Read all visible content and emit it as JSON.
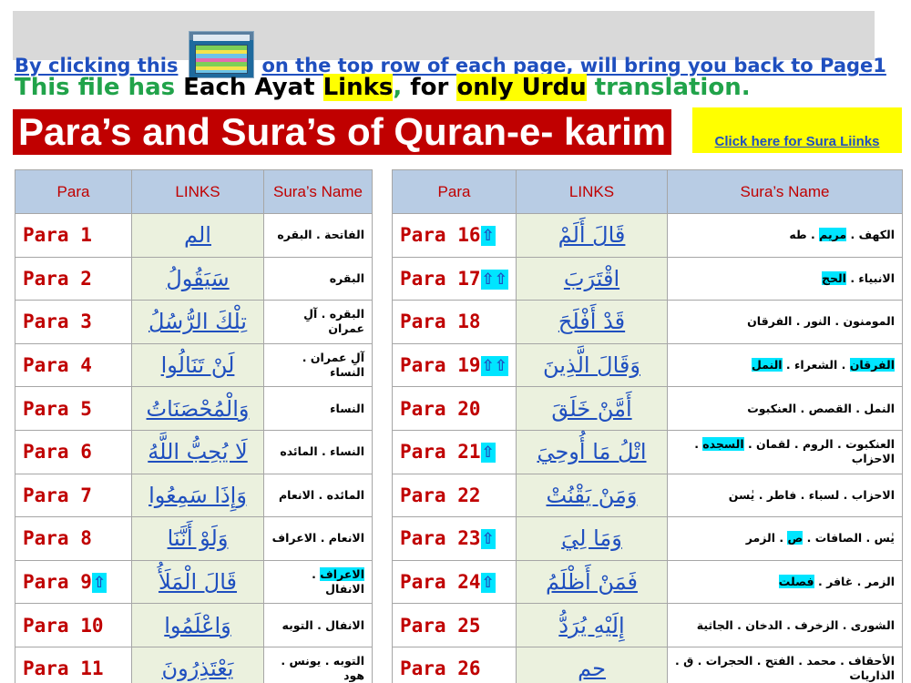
{
  "header": {
    "back_prefix": "By clicking this",
    "back_suffix": "on the top row of each page, will bring you back to Page1",
    "info": {
      "part1": "This file has ",
      "part2": "Each Ayat ",
      "part3": "Links",
      "part4": ",",
      "part5": " for ",
      "part6": "only Urdu",
      "part7": " translation."
    },
    "title": "Para’s and Sura’s of Quran-e- karim",
    "sura_link": "Click here for Sura Liinks"
  },
  "marker_glyph": "⇧",
  "left_table": {
    "headers": {
      "para": "Para",
      "links": "LINKS",
      "sura": "Sura’s Name"
    },
    "rows": [
      {
        "para": "Para  1",
        "markers": "",
        "link": "الم",
        "sura": [
          "الفاتحة . البقره"
        ]
      },
      {
        "para": "Para  2",
        "markers": "",
        "link": "سَيَقُولُ",
        "sura": [
          "البقره"
        ]
      },
      {
        "para": "Para  3",
        "markers": "",
        "link": "تِلْكَ الرُّسُلُ",
        "sura": [
          "البقره . آلِ عمران"
        ]
      },
      {
        "para": "Para  4",
        "markers": "",
        "link": "لَنْ تَنَالُوا",
        "sura": [
          "آلِ عمران . النساء"
        ]
      },
      {
        "para": "Para  5",
        "markers": "",
        "link": "وَالْمُحْصَنَاتُ",
        "sura": [
          "النساء"
        ]
      },
      {
        "para": "Para  6",
        "markers": "",
        "link": "لَا يُحِبُّ اللَّهُ",
        "sura": [
          "النساء . المائده"
        ]
      },
      {
        "para": "Para  7",
        "markers": "",
        "link": "وَإِذَا سَمِعُوا",
        "sura": [
          "المائده . الانعام"
        ]
      },
      {
        "para": "Para  8",
        "markers": "",
        "link": "وَلَوْ أَنَّنَا",
        "sura": [
          "الانعام . الاعراف"
        ]
      },
      {
        "para": "Para  9",
        "markers": "⇧",
        "link": "قَالَ الْمَلَأُ",
        "sura": [
          "الاعراف",
          " . الانفال"
        ],
        "sura_hl": [
          0
        ]
      },
      {
        "para": "Para  10",
        "markers": "",
        "link": "وَاعْلَمُوا",
        "sura": [
          "الانفال . التوبه"
        ]
      },
      {
        "para": "Para  11",
        "markers": "",
        "link": "يَعْتَذِرُونَ",
        "sura": [
          "التوبه . يونس . هود"
        ]
      }
    ]
  },
  "right_table": {
    "headers": {
      "para": "Para",
      "links": "LINKS",
      "sura": "Sura’s Name"
    },
    "rows": [
      {
        "para": "Para  16",
        "markers": "⇧",
        "link": "قَالَ أَلَمْ",
        "sura": [
          "الكهف . ",
          "مريم",
          " . طه"
        ],
        "sura_hl": [
          1
        ]
      },
      {
        "para": "Para  17",
        "markers": "⇧⇧",
        "link": "اقْتَرَبَ",
        "sura": [
          "الانبياء . ",
          "الحج"
        ],
        "sura_hl": [
          1
        ]
      },
      {
        "para": "Para  18",
        "markers": "",
        "link": "قَدْ أَفْلَحَ",
        "sura": [
          "المومنون . النور . الفرقان"
        ]
      },
      {
        "para": "Para  19",
        "markers": "⇧⇧",
        "link": "وَقَالَ الَّذِينَ",
        "sura": [
          "الفرقان",
          " . الشعراء . ",
          "النمل"
        ],
        "sura_hl": [
          0,
          2
        ]
      },
      {
        "para": "Para  20",
        "markers": "",
        "link": "أَمَّنْ خَلَقَ",
        "sura": [
          "النمل . القصص . العنكبوت"
        ]
      },
      {
        "para": "Para  21",
        "markers": "⇧",
        "link": "اتْلُ مَا أُوحِيَ",
        "sura": [
          "العنكبوت . الروم . لقمان . ",
          "السجده",
          " . الاحزاب"
        ],
        "sura_hl": [
          1
        ]
      },
      {
        "para": "Para  22",
        "markers": "",
        "link": "وَمَنْ يَقْنُتْ",
        "sura": [
          "الاحزاب . لسباء . فاطر . يٰسن"
        ]
      },
      {
        "para": "Para  23",
        "markers": "⇧",
        "link": "وَمَا لِيَ",
        "sura": [
          "يٰس . الصافات . ",
          "ص",
          " . الزمر"
        ],
        "sura_hl": [
          1
        ]
      },
      {
        "para": "Para  24",
        "markers": "⇧",
        "link": "فَمَنْ أَظْلَمُ",
        "sura": [
          "الزمر . غافر . ",
          "فصلت"
        ],
        "sura_hl": [
          1
        ]
      },
      {
        "para": "Para  25",
        "markers": "",
        "link": "إِلَيْهِ يُرَدُّ",
        "sura": [
          "الشورى . الزخرف . الدخان . الجاثية"
        ]
      },
      {
        "para": "Para  26",
        "markers": "",
        "link": "حم",
        "sura": [
          "الأحقاف . محمد . الفتح . الحجرات . ق . الذاريات"
        ]
      }
    ]
  },
  "colors": {
    "title_bg": "#c00000",
    "header_bg": "#b8cce4",
    "link_bg": "#ebf1de",
    "highlight_cyan": "#00e5ff",
    "highlight_yellow": "#ffff00",
    "link_blue": "#1f4fbf",
    "green_text": "#21a34a"
  }
}
